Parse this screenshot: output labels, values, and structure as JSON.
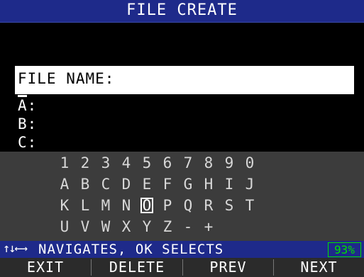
{
  "title": "FILE CREATE",
  "file_name_label": "FILE NAME:",
  "fields": [
    {
      "label": "A:"
    },
    {
      "label": "B:"
    },
    {
      "label": "C:"
    }
  ],
  "keyboard": {
    "rows": [
      [
        "1",
        "2",
        "3",
        "4",
        "5",
        "6",
        "7",
        "8",
        "9",
        "0"
      ],
      [
        "A",
        "B",
        "C",
        "D",
        "E",
        "F",
        "G",
        "H",
        "I",
        "J"
      ],
      [
        "K",
        "L",
        "M",
        "N",
        "O",
        "P",
        "Q",
        "R",
        "S",
        "T"
      ],
      [
        "U",
        "V",
        "W",
        "X",
        "Y",
        "Z",
        "-",
        "+"
      ]
    ],
    "selected": "O"
  },
  "status": {
    "arrows": "↑↓←→",
    "message": "NAVIGATES, OK SELECTS",
    "battery": "93%"
  },
  "softkeys": {
    "exit": "EXIT",
    "delete": "DELETE",
    "prev": "PREV",
    "next": "NEXT"
  },
  "colors": {
    "title_bar": "#1e2a8a",
    "keyboard_bg": "#3c3c3c",
    "battery": "#00e000"
  }
}
